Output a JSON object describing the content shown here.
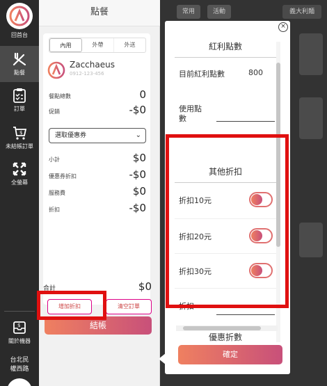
{
  "rail": {
    "home_label": "回首台",
    "items": [
      {
        "label": "點餐",
        "icon": "utensils-icon"
      },
      {
        "label": "訂單",
        "icon": "clipboard-icon"
      },
      {
        "label": "未結帳訂單",
        "icon": "cart-icon"
      },
      {
        "label": "全螢幕",
        "icon": "fullscreen-icon"
      }
    ],
    "settings_label": "關於機器",
    "store_line1": "台北民",
    "store_line2": "權西路"
  },
  "order_panel": {
    "title": "點餐",
    "tabs": [
      "內用",
      "外帶",
      "外送"
    ],
    "customer_name": "Zacchaeus",
    "customer_phone": "0912-123-456",
    "rows": [
      {
        "label": "餐點總數",
        "value": "0"
      },
      {
        "label": "促銷",
        "value": "-$0"
      }
    ],
    "coupon_placeholder": "選取優惠券",
    "summary": [
      {
        "label": "小計",
        "value": "$0"
      },
      {
        "label": "優惠券折扣",
        "value": "-$0"
      },
      {
        "label": "服務費",
        "value": "$0"
      },
      {
        "label": "折扣",
        "value": "-$0"
      }
    ],
    "total_label": "合計",
    "total_value": "$0",
    "add_discount": "增加折扣",
    "clear_order": "清空訂單",
    "checkout": "結帳"
  },
  "background": {
    "tabs": [
      "常用",
      "活動",
      "漢堡",
      "義大利麵"
    ]
  },
  "popup": {
    "bonus_title": "紅利點數",
    "current_points_label": "目前紅利點數",
    "current_points_value": "800",
    "use_points_label_1": "使用點",
    "use_points_label_2": "數",
    "other_title": "其他折扣",
    "discounts": [
      {
        "label": "折扣10元",
        "on": true
      },
      {
        "label": "折扣20元",
        "on": true
      },
      {
        "label": "折扣30元",
        "on": true
      }
    ],
    "custom_discount_label": "折扣",
    "promo_title": "優惠折數",
    "confirm": "確定"
  },
  "colors": {
    "accent_start": "#ef8060",
    "accent_end": "#c8507a",
    "highlight": "#e01010"
  }
}
